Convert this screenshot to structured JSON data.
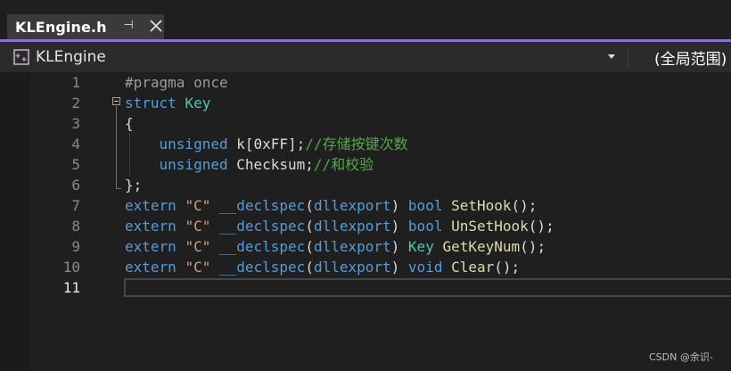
{
  "tab": {
    "title": "KLEngine.h",
    "pin_glyph": "⊣",
    "close_icon": "close-icon"
  },
  "navbar": {
    "scope_label": "KLEngine",
    "global_scope": "(全局范围)"
  },
  "editor": {
    "active_line": 11,
    "line_numbers": [
      "1",
      "2",
      "3",
      "4",
      "5",
      "6",
      "7",
      "8",
      "9",
      "10",
      "11"
    ],
    "lines": [
      [
        {
          "t": "#pragma once",
          "c": "pre"
        }
      ],
      [
        {
          "t": "struct",
          "c": "kw"
        },
        {
          "t": " ",
          "c": "plain"
        },
        {
          "t": "Key",
          "c": "type"
        }
      ],
      [
        {
          "t": "{",
          "c": "plain"
        }
      ],
      [
        {
          "t": "    ",
          "c": "plain"
        },
        {
          "t": "unsigned",
          "c": "kw"
        },
        {
          "t": " k[0xFF];",
          "c": "plain"
        },
        {
          "t": "//存储按键次数",
          "c": "cmt"
        }
      ],
      [
        {
          "t": "    ",
          "c": "plain"
        },
        {
          "t": "unsigned",
          "c": "kw"
        },
        {
          "t": " Checksum;",
          "c": "plain"
        },
        {
          "t": "//和校验",
          "c": "cmt"
        }
      ],
      [
        {
          "t": "};",
          "c": "plain"
        }
      ],
      [
        {
          "t": "extern",
          "c": "kw"
        },
        {
          "t": " ",
          "c": "plain"
        },
        {
          "t": "\"C\"",
          "c": "str"
        },
        {
          "t": " ",
          "c": "plain"
        },
        {
          "t": "__declspec",
          "c": "kw"
        },
        {
          "t": "(",
          "c": "plain"
        },
        {
          "t": "dllexport",
          "c": "kw"
        },
        {
          "t": ") ",
          "c": "plain"
        },
        {
          "t": "bool",
          "c": "kw"
        },
        {
          "t": " ",
          "c": "plain"
        },
        {
          "t": "SetHook",
          "c": "fn"
        },
        {
          "t": "();",
          "c": "plain"
        }
      ],
      [
        {
          "t": "extern",
          "c": "kw"
        },
        {
          "t": " ",
          "c": "plain"
        },
        {
          "t": "\"C\"",
          "c": "str"
        },
        {
          "t": " ",
          "c": "plain"
        },
        {
          "t": "__declspec",
          "c": "kw"
        },
        {
          "t": "(",
          "c": "plain"
        },
        {
          "t": "dllexport",
          "c": "kw"
        },
        {
          "t": ") ",
          "c": "plain"
        },
        {
          "t": "bool",
          "c": "kw"
        },
        {
          "t": " ",
          "c": "plain"
        },
        {
          "t": "UnSetHook",
          "c": "fn"
        },
        {
          "t": "();",
          "c": "plain"
        }
      ],
      [
        {
          "t": "extern",
          "c": "kw"
        },
        {
          "t": " ",
          "c": "plain"
        },
        {
          "t": "\"C\"",
          "c": "str"
        },
        {
          "t": " ",
          "c": "plain"
        },
        {
          "t": "__declspec",
          "c": "kw"
        },
        {
          "t": "(",
          "c": "plain"
        },
        {
          "t": "dllexport",
          "c": "kw"
        },
        {
          "t": ") ",
          "c": "plain"
        },
        {
          "t": "Key",
          "c": "type"
        },
        {
          "t": " ",
          "c": "plain"
        },
        {
          "t": "GetKeyNum",
          "c": "fn"
        },
        {
          "t": "();",
          "c": "plain"
        }
      ],
      [
        {
          "t": "extern",
          "c": "kw"
        },
        {
          "t": " ",
          "c": "plain"
        },
        {
          "t": "\"C\"",
          "c": "str"
        },
        {
          "t": " ",
          "c": "plain"
        },
        {
          "t": "__declspec",
          "c": "kw"
        },
        {
          "t": "(",
          "c": "plain"
        },
        {
          "t": "dllexport",
          "c": "kw"
        },
        {
          "t": ") ",
          "c": "plain"
        },
        {
          "t": "void",
          "c": "kw"
        },
        {
          "t": " ",
          "c": "plain"
        },
        {
          "t": "Clear",
          "c": "fn"
        },
        {
          "t": "();",
          "c": "plain"
        }
      ],
      [
        {
          "t": "",
          "c": "plain"
        }
      ]
    ]
  },
  "colors": {
    "keyword": "#569cd6",
    "type": "#4ec9b0",
    "function": "#dcdcaa",
    "string": "#d69d85",
    "comment": "#57a64a",
    "accent": "#8d6fd8"
  },
  "watermark": "CSDN @余识-"
}
